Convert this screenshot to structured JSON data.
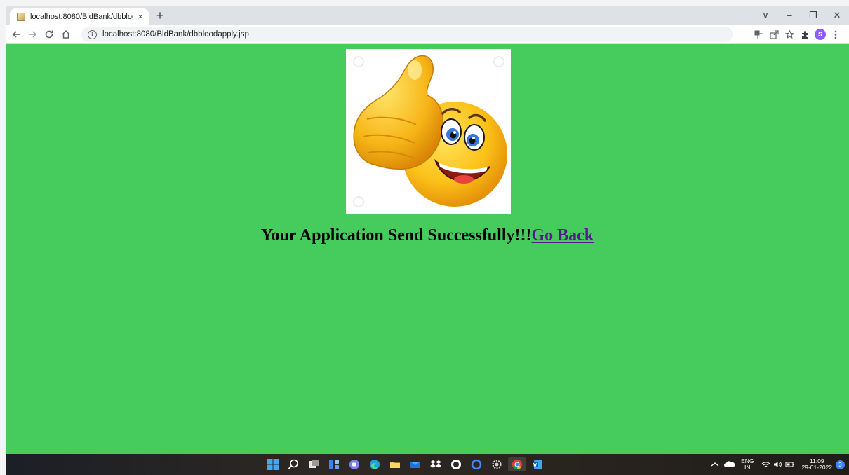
{
  "browser": {
    "tab_title": "localhost:8080/BldBank/dbblood",
    "tab_close": "×",
    "new_tab": "+",
    "url": "localhost:8080/BldBank/dbbloodapply.jsp",
    "profile_initial": "S",
    "window_controls": [
      "∨",
      "–",
      "❐",
      "✕"
    ]
  },
  "page": {
    "message": "Your Application Send Successfully!!!",
    "link_label": "Go Back",
    "background_color": "#46cc5d",
    "image_icon": "thumbs-up-emoji"
  },
  "taskbar": {
    "language": "ENG",
    "region": "IN",
    "time": "11:09",
    "date": "29-01-2022",
    "notification_count": "3",
    "apps": [
      "start",
      "search",
      "task-view",
      "widgets",
      "chat",
      "edge",
      "file-explorer",
      "mail",
      "dropbox",
      "github",
      "cortana",
      "settings",
      "chrome",
      "word"
    ]
  }
}
